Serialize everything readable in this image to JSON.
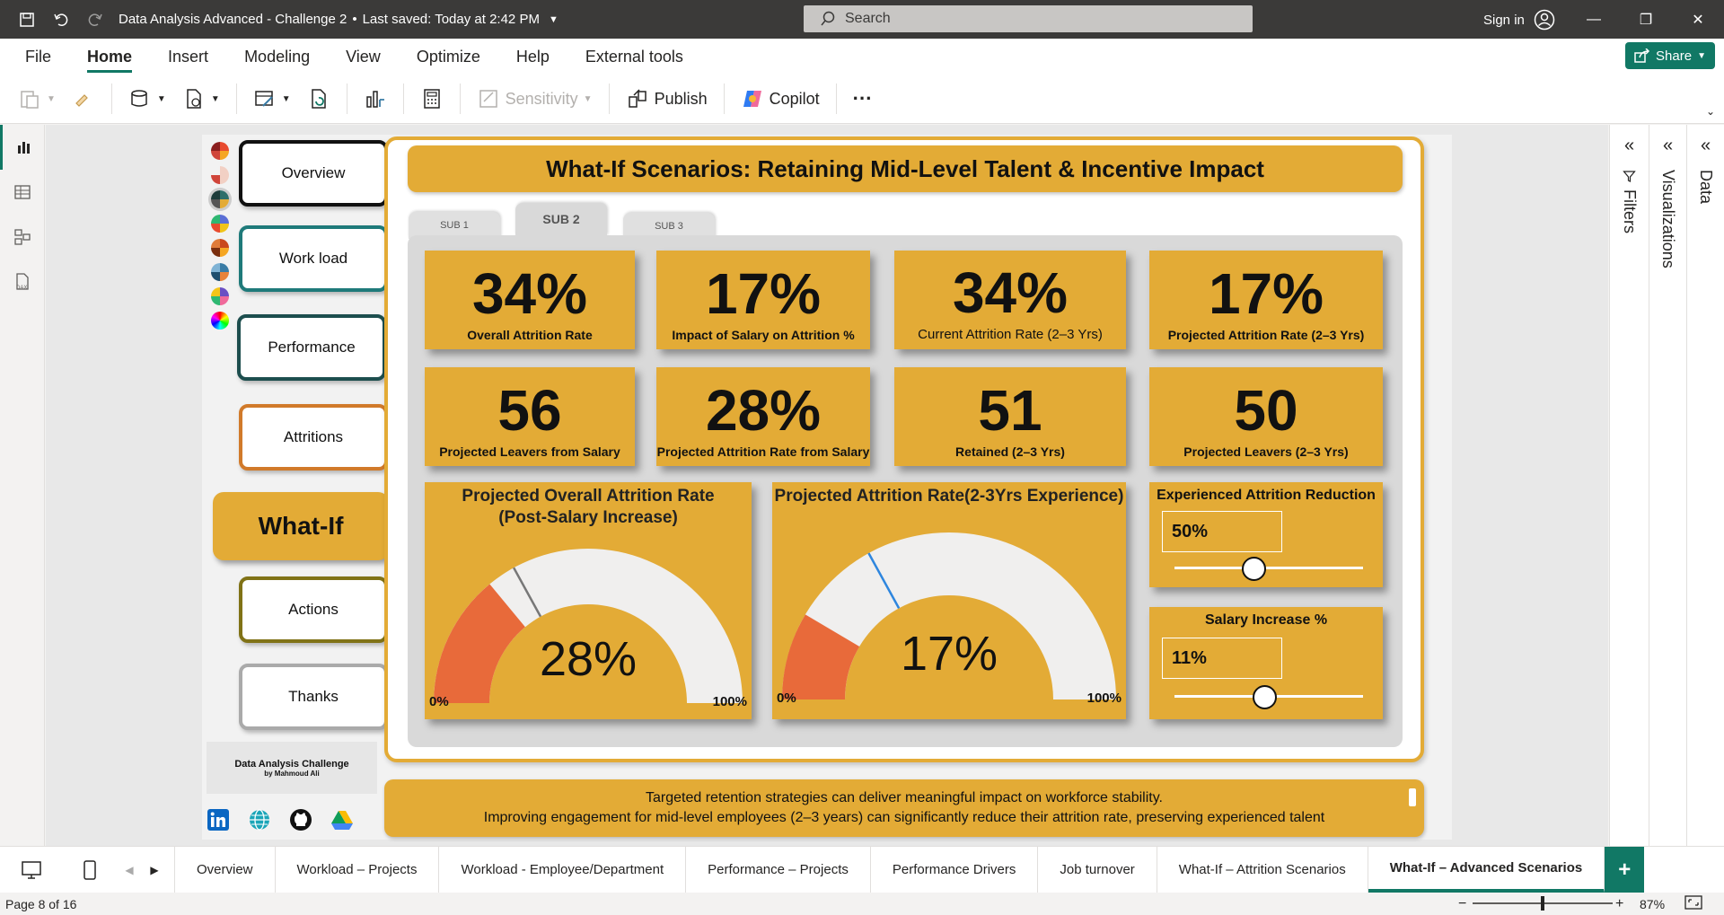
{
  "window": {
    "title": "Data Analysis Advanced - Challenge 2",
    "saved": "Last saved: Today at 2:42 PM",
    "search_placeholder": "Search",
    "signin": "Sign in"
  },
  "menu": {
    "items": [
      "File",
      "Home",
      "Insert",
      "Modeling",
      "View",
      "Optimize",
      "Help",
      "External tools"
    ],
    "active": "Home",
    "share": "Share"
  },
  "ribbon": {
    "sensitivity": "Sensitivity",
    "publish": "Publish",
    "copilot": "Copilot",
    "more": "···"
  },
  "panes": {
    "filters": "Filters",
    "visualizations": "Visualizations",
    "data": "Data"
  },
  "nav": {
    "overview": "Overview",
    "workload": "Work load",
    "performance": "Performance",
    "attritions": "Attritions",
    "whatif": "What-If",
    "actions": "Actions",
    "thanks": "Thanks",
    "credit_title": "Data Analysis Challenge",
    "credit_by": "by Mahmoud Ali",
    "palette_colors": [
      "#e84a2f",
      "#d0453a",
      "#2e6f6a",
      "#5b6fd6",
      "#c9471c",
      "#3a7ca5",
      "#6a4fc4",
      "#b43ad6"
    ]
  },
  "report": {
    "title": "What-If Scenarios: Retaining Mid-Level Talent & Incentive Impact",
    "tabs": [
      "SUB 1",
      "SUB 2",
      "SUB 3"
    ],
    "active_tab": "SUB 2",
    "kpis": [
      {
        "value": "34%",
        "label": "Overall Attrition Rate"
      },
      {
        "value": "17%",
        "label": "Impact of Salary on Attrition %"
      },
      {
        "value": "34%",
        "label": "Current Attrition Rate (2–3 Yrs)"
      },
      {
        "value": "17%",
        "label": "Projected Attrition Rate (2–3 Yrs)"
      },
      {
        "value": "56",
        "label": "Projected Leavers from Salary"
      },
      {
        "value": "28%",
        "label": "Projected Attrition Rate from Salary"
      },
      {
        "value": "51",
        "label": "Retained (2–3 Yrs)"
      },
      {
        "value": "50",
        "label": "Projected Leavers (2–3 Yrs)"
      }
    ],
    "gauge1": {
      "title_line1": "Projected Overall Attrition Rate",
      "title_line2": "(Post-Salary Increase)",
      "value_label": "28%",
      "value": 0.28,
      "target": 0.34,
      "min": "0%",
      "max": "100%",
      "fill": "#e86a3a",
      "target_color": "#777777"
    },
    "gauge2": {
      "title_line1": "Projected Attrition Rate(2-3Yrs Experience)",
      "value_label": "17%",
      "value": 0.17,
      "target": 0.34,
      "min": "0%",
      "max": "100%",
      "fill": "#e86a3a",
      "target_color": "#2e86de"
    },
    "slider1": {
      "title": "Experienced Attrition Reduction",
      "value": "50%",
      "position": 0.42
    },
    "slider2": {
      "title": "Salary Increase %",
      "value": "11%",
      "position": 0.48
    },
    "footer_line1": "Targeted retention strategies can deliver meaningful impact on workforce stability.",
    "footer_line2": "Improving engagement for mid-level employees (2–3 years) can significantly reduce their attrition rate, preserving experienced talent"
  },
  "pages": {
    "tabs": [
      "Overview",
      "Workload – Projects",
      "Workload - Employee/Department",
      "Performance – Projects",
      "Performance Drivers",
      "Job turnover",
      "What-If – Attrition Scenarios",
      "What-If – Advanced Scenarios"
    ],
    "active": "What-If – Advanced Scenarios"
  },
  "status": {
    "page": "Page 8 of 16",
    "zoom": "87%",
    "zoom_level": 0.5
  },
  "colors": {
    "accent": "#e3ab36",
    "brand": "#117865",
    "gauge_fill": "#e86a3a",
    "gauge_track": "#f0efee"
  }
}
